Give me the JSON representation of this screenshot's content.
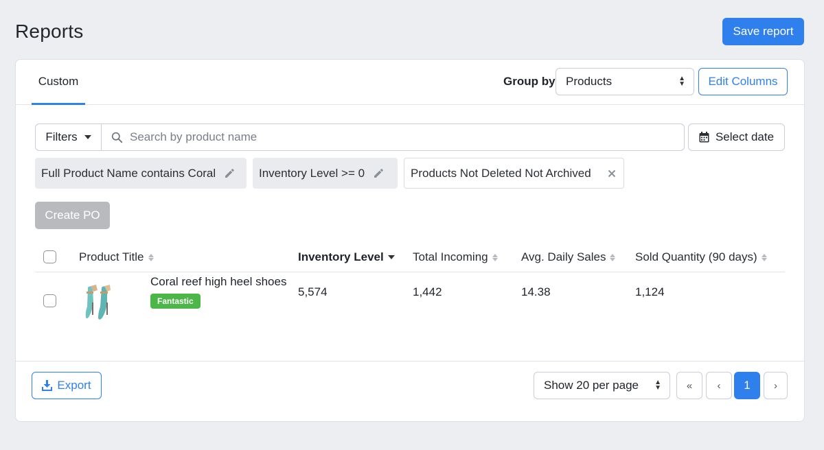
{
  "header": {
    "title": "Reports",
    "save_label": "Save report"
  },
  "tabs": [
    {
      "label": "Custom",
      "active": true
    }
  ],
  "group_by": {
    "label": "Group by",
    "selected": "Products"
  },
  "edit_columns_label": "Edit Columns",
  "toolbar": {
    "filters_label": "Filters",
    "search_placeholder": "Search by product name",
    "search_value": "",
    "select_date_label": "Select date"
  },
  "active_filters": [
    {
      "label": "Full Product Name contains Coral",
      "icon": "pencil-icon"
    },
    {
      "label": "Inventory Level >= 0",
      "icon": "pencil-icon"
    },
    {
      "label": "Products Not Deleted Not Archived",
      "icon": "close-icon"
    }
  ],
  "create_po_label": "Create PO",
  "table": {
    "columns": [
      {
        "label": "Product Title",
        "sorted": false
      },
      {
        "label": "Inventory Level",
        "sorted": true,
        "direction": "desc"
      },
      {
        "label": "Total Incoming",
        "sorted": false
      },
      {
        "label": "Avg. Daily Sales",
        "sorted": false
      },
      {
        "label": "Sold Quantity (90 days)",
        "sorted": false
      }
    ],
    "rows": [
      {
        "product_title": "Coral reef high heel shoes",
        "badge": "Fantastic",
        "inventory_level": "5,574",
        "total_incoming": "1,442",
        "avg_daily_sales": "14.38",
        "sold_quantity": "1,124"
      }
    ]
  },
  "footer": {
    "export_label": "Export",
    "per_page_selected": "Show 20 per page",
    "pagination": {
      "first": "«",
      "prev": "‹",
      "current": "1",
      "next": "›"
    }
  },
  "colors": {
    "primary": "#2f80ed",
    "badge_green": "#4cb648",
    "disabled": "#b8babd",
    "background": "#eceef2"
  }
}
